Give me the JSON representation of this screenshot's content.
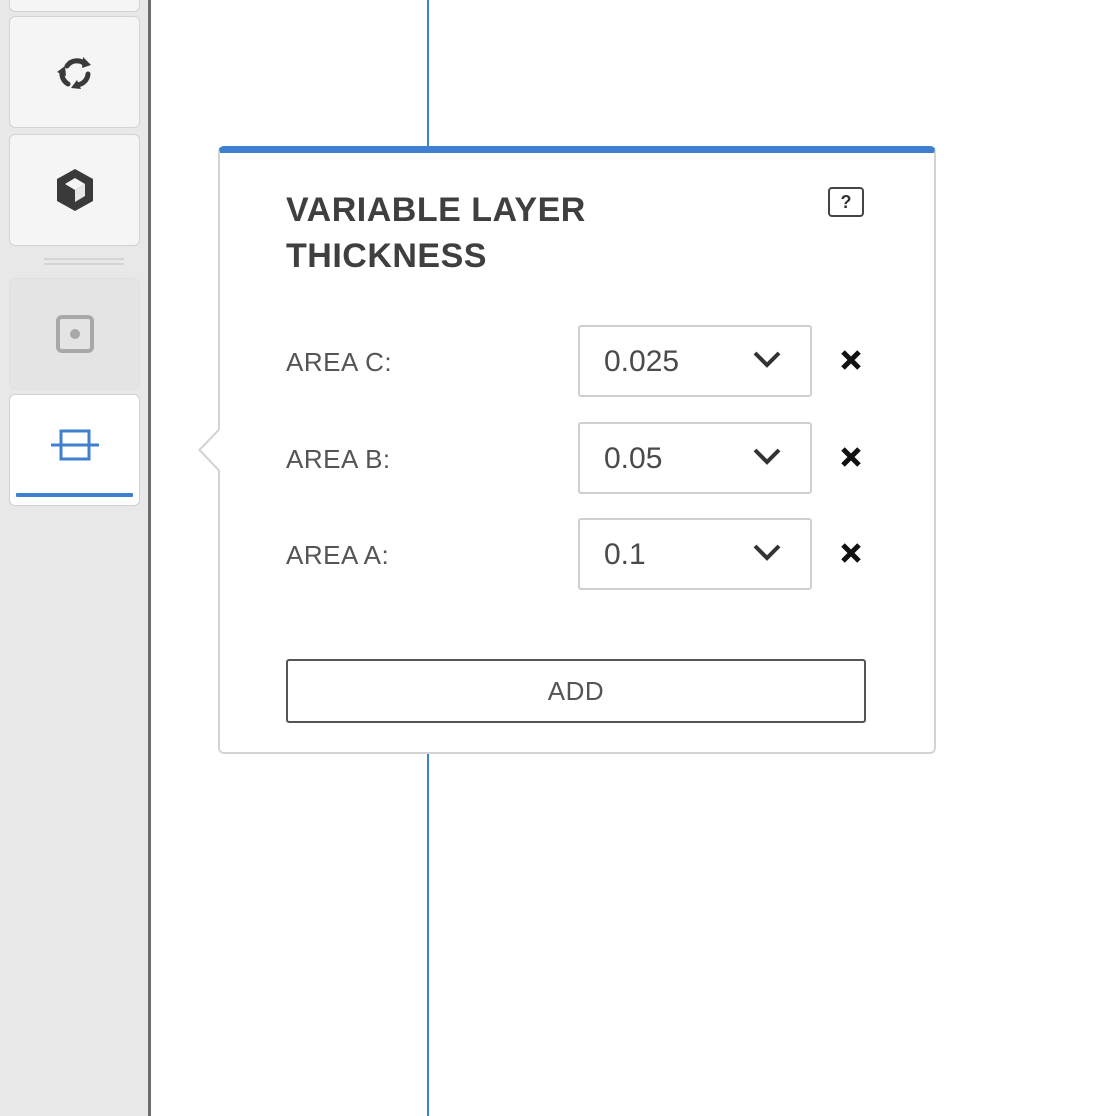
{
  "toolbar": {
    "items": [
      {
        "icon": "recycle-icon",
        "state": "normal"
      },
      {
        "icon": "cube-icon",
        "state": "normal"
      },
      {
        "icon": "dot-square-icon",
        "state": "disabled"
      },
      {
        "icon": "layer-thickness-icon",
        "state": "active"
      }
    ],
    "accent_color": "#3f7fcf"
  },
  "panel": {
    "title": "VARIABLE LAYER THICKNESS",
    "help_label": "?",
    "areas": [
      {
        "label": "AREA C:",
        "value": "0.025"
      },
      {
        "label": "AREA B:",
        "value": "0.05"
      },
      {
        "label": "AREA A:",
        "value": "0.1"
      }
    ],
    "add_label": "ADD",
    "accent_color": "#3f7fcf"
  }
}
